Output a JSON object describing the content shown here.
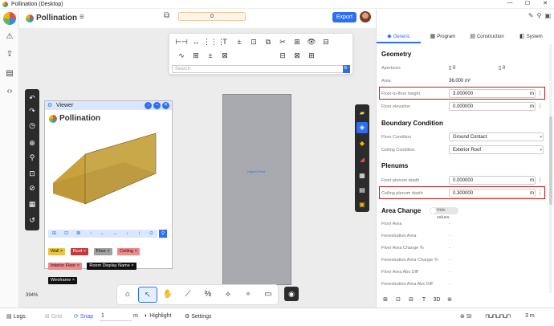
{
  "window": {
    "title": "Pollination (Desktop)",
    "minimize": "—",
    "maximize": "☐",
    "close": "✕"
  },
  "topbar": {
    "brand": "Pollination",
    "counter": "0",
    "export_label": "Export"
  },
  "toolpanel": {
    "row1": [
      "⊢⊣",
      "↔",
      "⋮⋮⋮",
      "T",
      "±",
      "⊡",
      "⧉",
      "✂",
      "⊞",
      "👁",
      "⊟"
    ],
    "row2": [
      "∿",
      "⊞",
      "±",
      "⊠",
      "",
      "",
      "",
      "⊟",
      "⊠",
      "⊞"
    ],
    "search_placeholder": "Search",
    "search_icon": "🔍"
  },
  "viewer": {
    "title": "Viewer",
    "brand": "Pollination",
    "toolbar_icons": [
      "⊞",
      "⊡",
      "⊠",
      "↑",
      "←",
      "→",
      "↓",
      "↕",
      "⊙"
    ],
    "tags": [
      {
        "label": "Wall ×",
        "color": "#e8c547"
      },
      {
        "label": "Roof ×",
        "color": "#c23b3b"
      },
      {
        "label": "Floor ×",
        "color": "#a0a0a0"
      },
      {
        "label": "Ceiling ×",
        "color": "#f28a8a"
      },
      {
        "label": "Interior Floor ×",
        "color": "#f28a8a"
      },
      {
        "label": "Room Display Name ×",
        "color": "#111111"
      },
      {
        "label": "Wireframe ×",
        "color": "#111111"
      }
    ]
  },
  "viewport": {
    "room_label": "Hipped Roof",
    "zoom": "394%"
  },
  "panel": {
    "tabs": [
      {
        "label": "Generic",
        "icon": "◆",
        "active": true
      },
      {
        "label": "Program",
        "icon": "▦",
        "active": false
      },
      {
        "label": "Construction",
        "icon": "▤",
        "active": false
      },
      {
        "label": "System",
        "icon": "◧",
        "active": false
      }
    ],
    "geometry": {
      "title": "Geometry",
      "apertures_label": "Apertures",
      "apertures_value_a": "0",
      "apertures_value_b": "0",
      "area_label": "Area",
      "area_value": "36.000 m²",
      "f2f_label": "Floor-to-floor height",
      "f2f_value": "3.000000",
      "floor_elev_label": "Floor elevation",
      "floor_elev_value": "0.000000",
      "unit": "m"
    },
    "boundary": {
      "title": "Boundary Condition",
      "floor_label": "Floor Condition",
      "floor_value": "Ground Contact",
      "ceiling_label": "Ceiling Condition",
      "ceiling_value": "Exterior Roof"
    },
    "plenums": {
      "title": "Plenums",
      "floor_label": "Floor plenum depth",
      "floor_value": "0.000000",
      "ceiling_label": "Ceiling plenum depth",
      "ceiling_value": "0.300000"
    },
    "area_change": {
      "title": "Area Change",
      "toggle": "Hide values",
      "rows": [
        "Floor Area",
        "Fenestration Area",
        "Floor Area Change %",
        "Fenestration Area Change %",
        "Floor Area Abs Diff",
        "Fenestration Area Abs Diff"
      ],
      "dash": "-"
    },
    "bottom_icons": [
      "⊞",
      "⊡",
      "⊟",
      "T",
      "3D",
      "⊛"
    ]
  },
  "statusbar": {
    "logs": "Logs",
    "grid": "Grid",
    "snap": "Snap",
    "snap_value": "1",
    "unit": "m",
    "highlight": "Highlight",
    "settings": "Settings",
    "si": "SI",
    "scale": "3 m"
  }
}
